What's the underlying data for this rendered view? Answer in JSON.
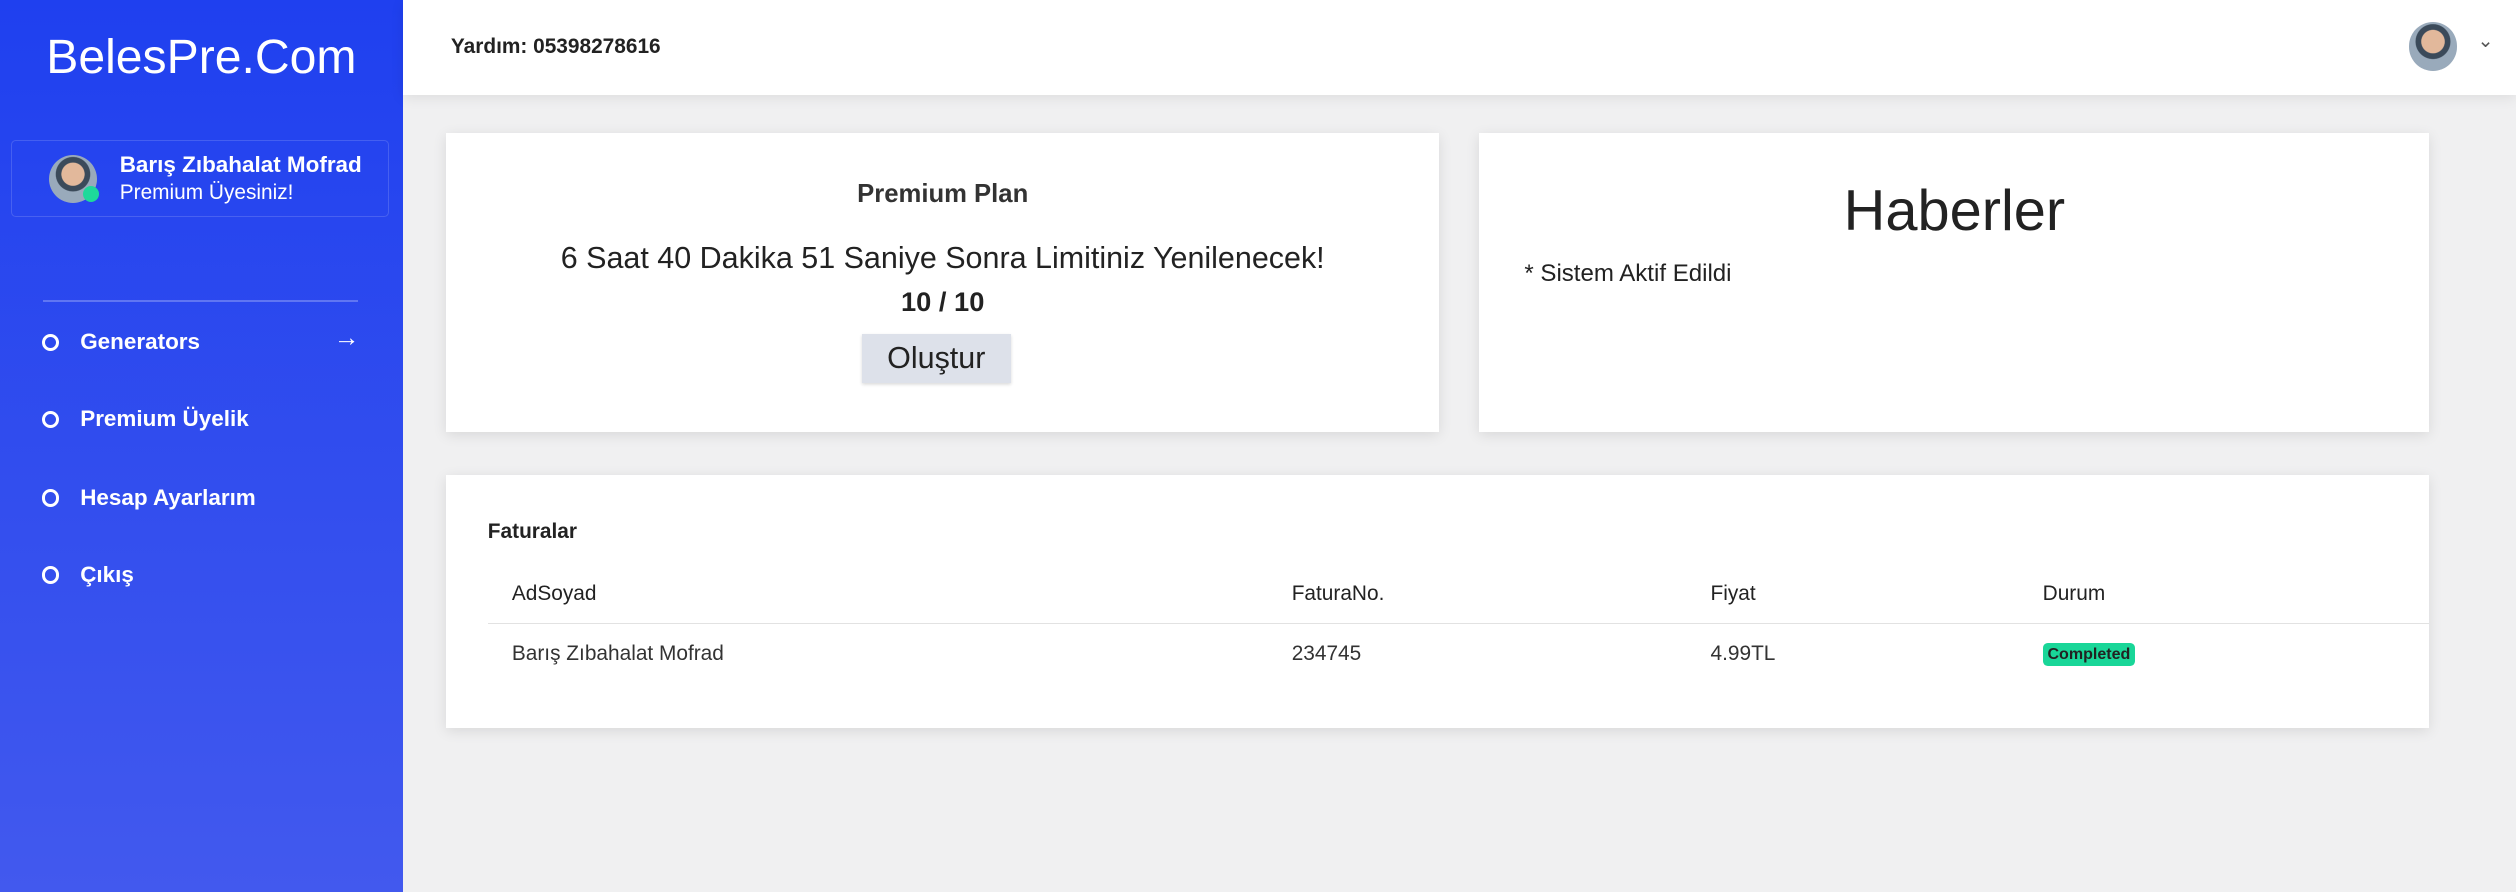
{
  "sidebar": {
    "logo": "BelesPre.Com",
    "user": {
      "name": "Barış Zıbahalat Mofrad",
      "status": "Premium Üyesiniz!"
    },
    "items": [
      {
        "label": "Generators"
      },
      {
        "label": "Premium Üyelik"
      },
      {
        "label": "Hesap Ayarlarım"
      },
      {
        "label": "Çıkış"
      }
    ]
  },
  "header": {
    "help": "Yardım: 05398278616"
  },
  "plan": {
    "title": "Premium Plan",
    "countdown": "6 Saat 40 Dakika 51 Saniye Sonra Limitiniz Yenilenecek!",
    "count": "10 / 10",
    "button": "Oluştur"
  },
  "news": {
    "title": "Haberler",
    "items": [
      "* Sistem Aktif Edildi"
    ]
  },
  "invoices": {
    "title": "Faturalar",
    "columns": [
      "AdSoyad",
      "FaturaNo.",
      "Fiyat",
      "Durum"
    ],
    "rows": [
      {
        "name": "Barış Zıbahalat Mofrad",
        "no": "234745",
        "price": "4.99TL",
        "status": "Completed"
      }
    ]
  }
}
